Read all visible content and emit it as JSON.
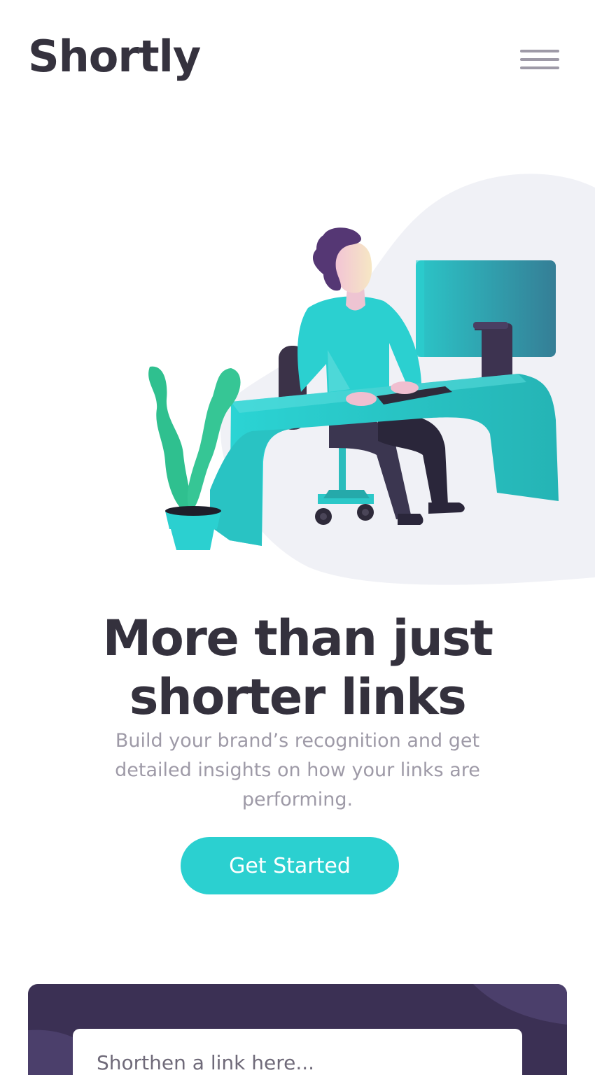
{
  "header": {
    "logo_text": "Shortly",
    "menu_icon": "hamburger-menu-icon"
  },
  "hero": {
    "illustration": "person-working-at-desk-illustration",
    "title": "More than just shorter links",
    "subtitle": "Build your brand’s recognition and get detailed insights on how your links are performing.",
    "cta_label": "Get Started"
  },
  "shorten": {
    "placeholder": "Shorthen a link here..."
  },
  "colors": {
    "cyan": "#2bd0d0",
    "dark_violet": "#3b3054",
    "heading": "#34313d",
    "gray_text": "#9e9aa7",
    "blob": "#f0f1f6"
  }
}
